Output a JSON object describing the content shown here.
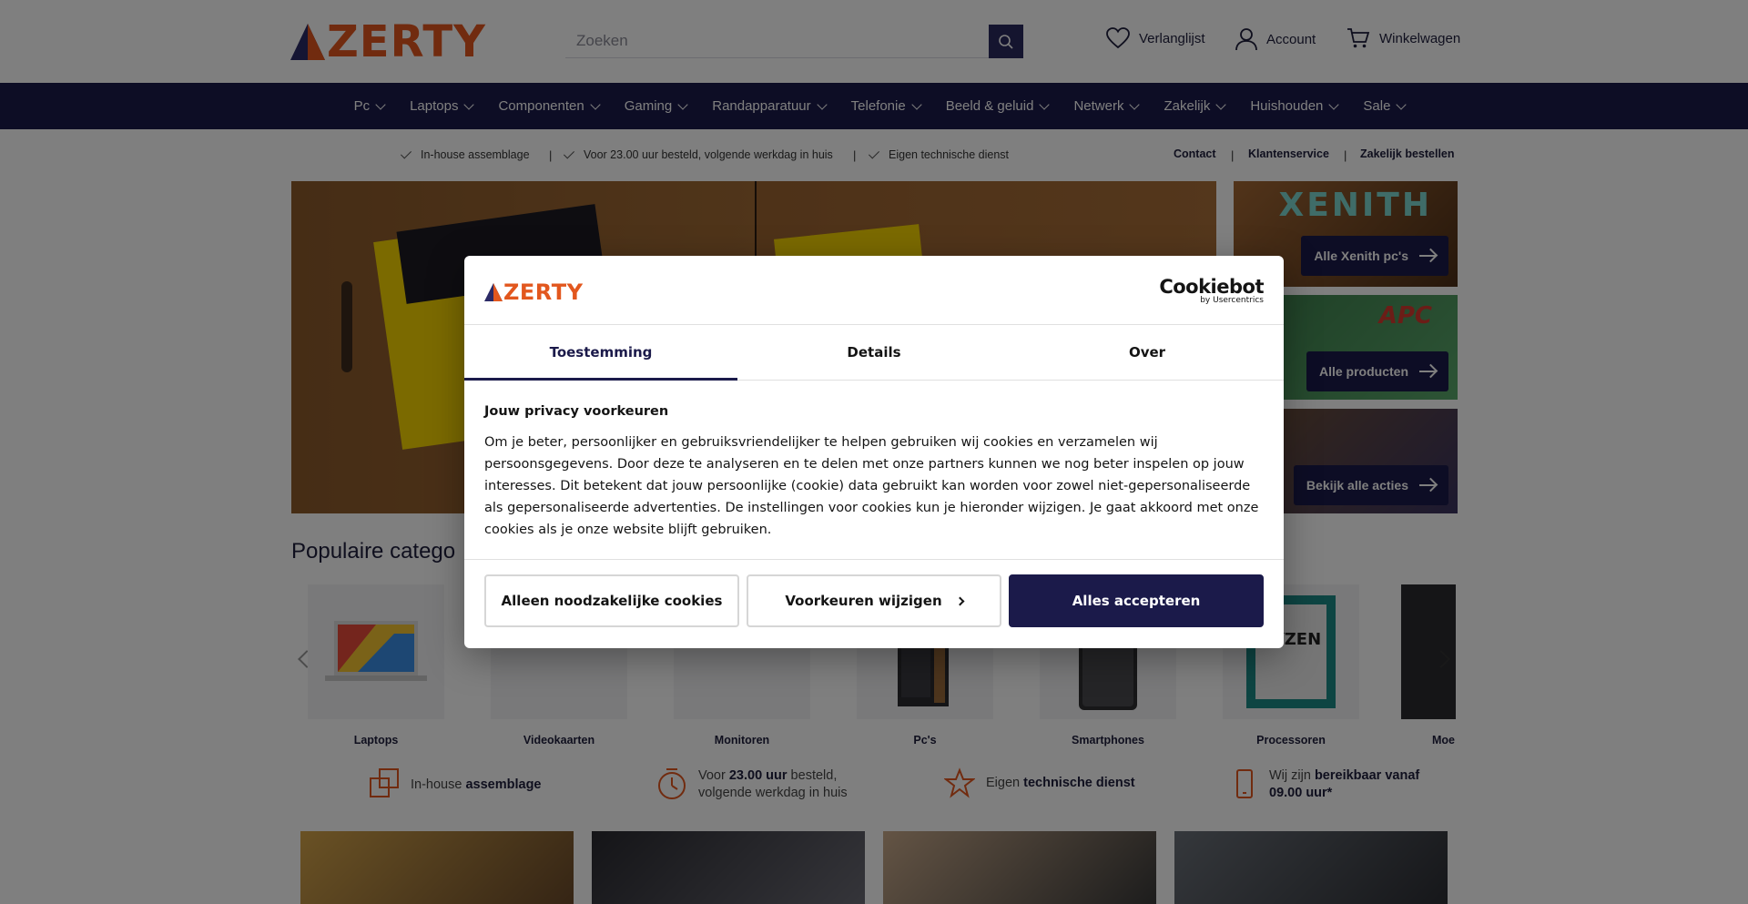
{
  "header": {
    "logo_text": "ZERTY",
    "search_placeholder": "Zoeken",
    "wishlist_label": "Verlanglijst",
    "account_label": "Account",
    "cart_label": "Winkelwagen"
  },
  "nav": {
    "items": [
      "Pc",
      "Laptops",
      "Componenten",
      "Gaming",
      "Randapparatuur",
      "Telefonie",
      "Beeld & geluid",
      "Netwerk",
      "Zakelijk",
      "Huishouden",
      "Sale"
    ]
  },
  "usp_bar": {
    "items": [
      "In-house assemblage",
      "Voor 23.00 uur besteld, volgende werkdag in huis",
      "Eigen technische dienst"
    ],
    "separator": "|",
    "links": [
      "Contact",
      "Klantenservice",
      "Zakelijk bestellen"
    ]
  },
  "side_banners": [
    {
      "title": "XENITH",
      "button": "Alle Xenith pc's"
    },
    {
      "title": "APC",
      "button": "Alle producten"
    },
    {
      "title": "",
      "button": "Bekijk alle acties"
    }
  ],
  "popular": {
    "title": "Populaire catego",
    "categories": [
      "Laptops",
      "Videokaarten",
      "Monitoren",
      "Pc's",
      "Smartphones",
      "Processoren",
      "Moe"
    ]
  },
  "usp_row": [
    {
      "pre": "In-house ",
      "bold": "assemblage",
      "post": "",
      "icon": "assembly-icon"
    },
    {
      "pre": "Voor ",
      "bold": "23.00 uur",
      "post": " besteld, volgende werkdag in huis",
      "icon": "clock-icon"
    },
    {
      "pre": "Eigen ",
      "bold": "technische dienst",
      "post": "",
      "icon": "star-icon"
    },
    {
      "pre": "Wij zijn ",
      "bold": "bereikbaar vanaf 09.00 uur*",
      "post": "",
      "icon": "phone-icon"
    }
  ],
  "cookie_modal": {
    "logo_text": "ZERTY",
    "provider_name": "Cookiebot",
    "provider_by": "by Usercentrics",
    "tabs": [
      "Toestemming",
      "Details",
      "Over"
    ],
    "active_tab": "Toestemming",
    "heading": "Jouw privacy voorkeuren",
    "body": "Om je beter, persoonlijker en gebruiksvriendelijker te helpen gebruiken wij cookies en verzamelen wij persoonsgegevens. Door deze te analyseren en te delen met onze partners kunnen we nog beter inspelen op jouw interesses. Dit betekent dat jouw persoonlijke (cookie) data gebruikt kan worden voor zowel niet-gepersonaliseerde als gepersonaliseerde advertenties. De instellingen voor cookies kun je hieronder wijzigen. Je gaat akkoord met onze cookies als je onze website blijft gebruiken.",
    "buttons": {
      "necessary": "Alleen noodzakelijke cookies",
      "preferences": "Voorkeuren wijzigen",
      "accept_all": "Alles accepteren"
    }
  },
  "colors": {
    "brand_navy": "#1b1a4a",
    "brand_orange": "#e2571e"
  }
}
